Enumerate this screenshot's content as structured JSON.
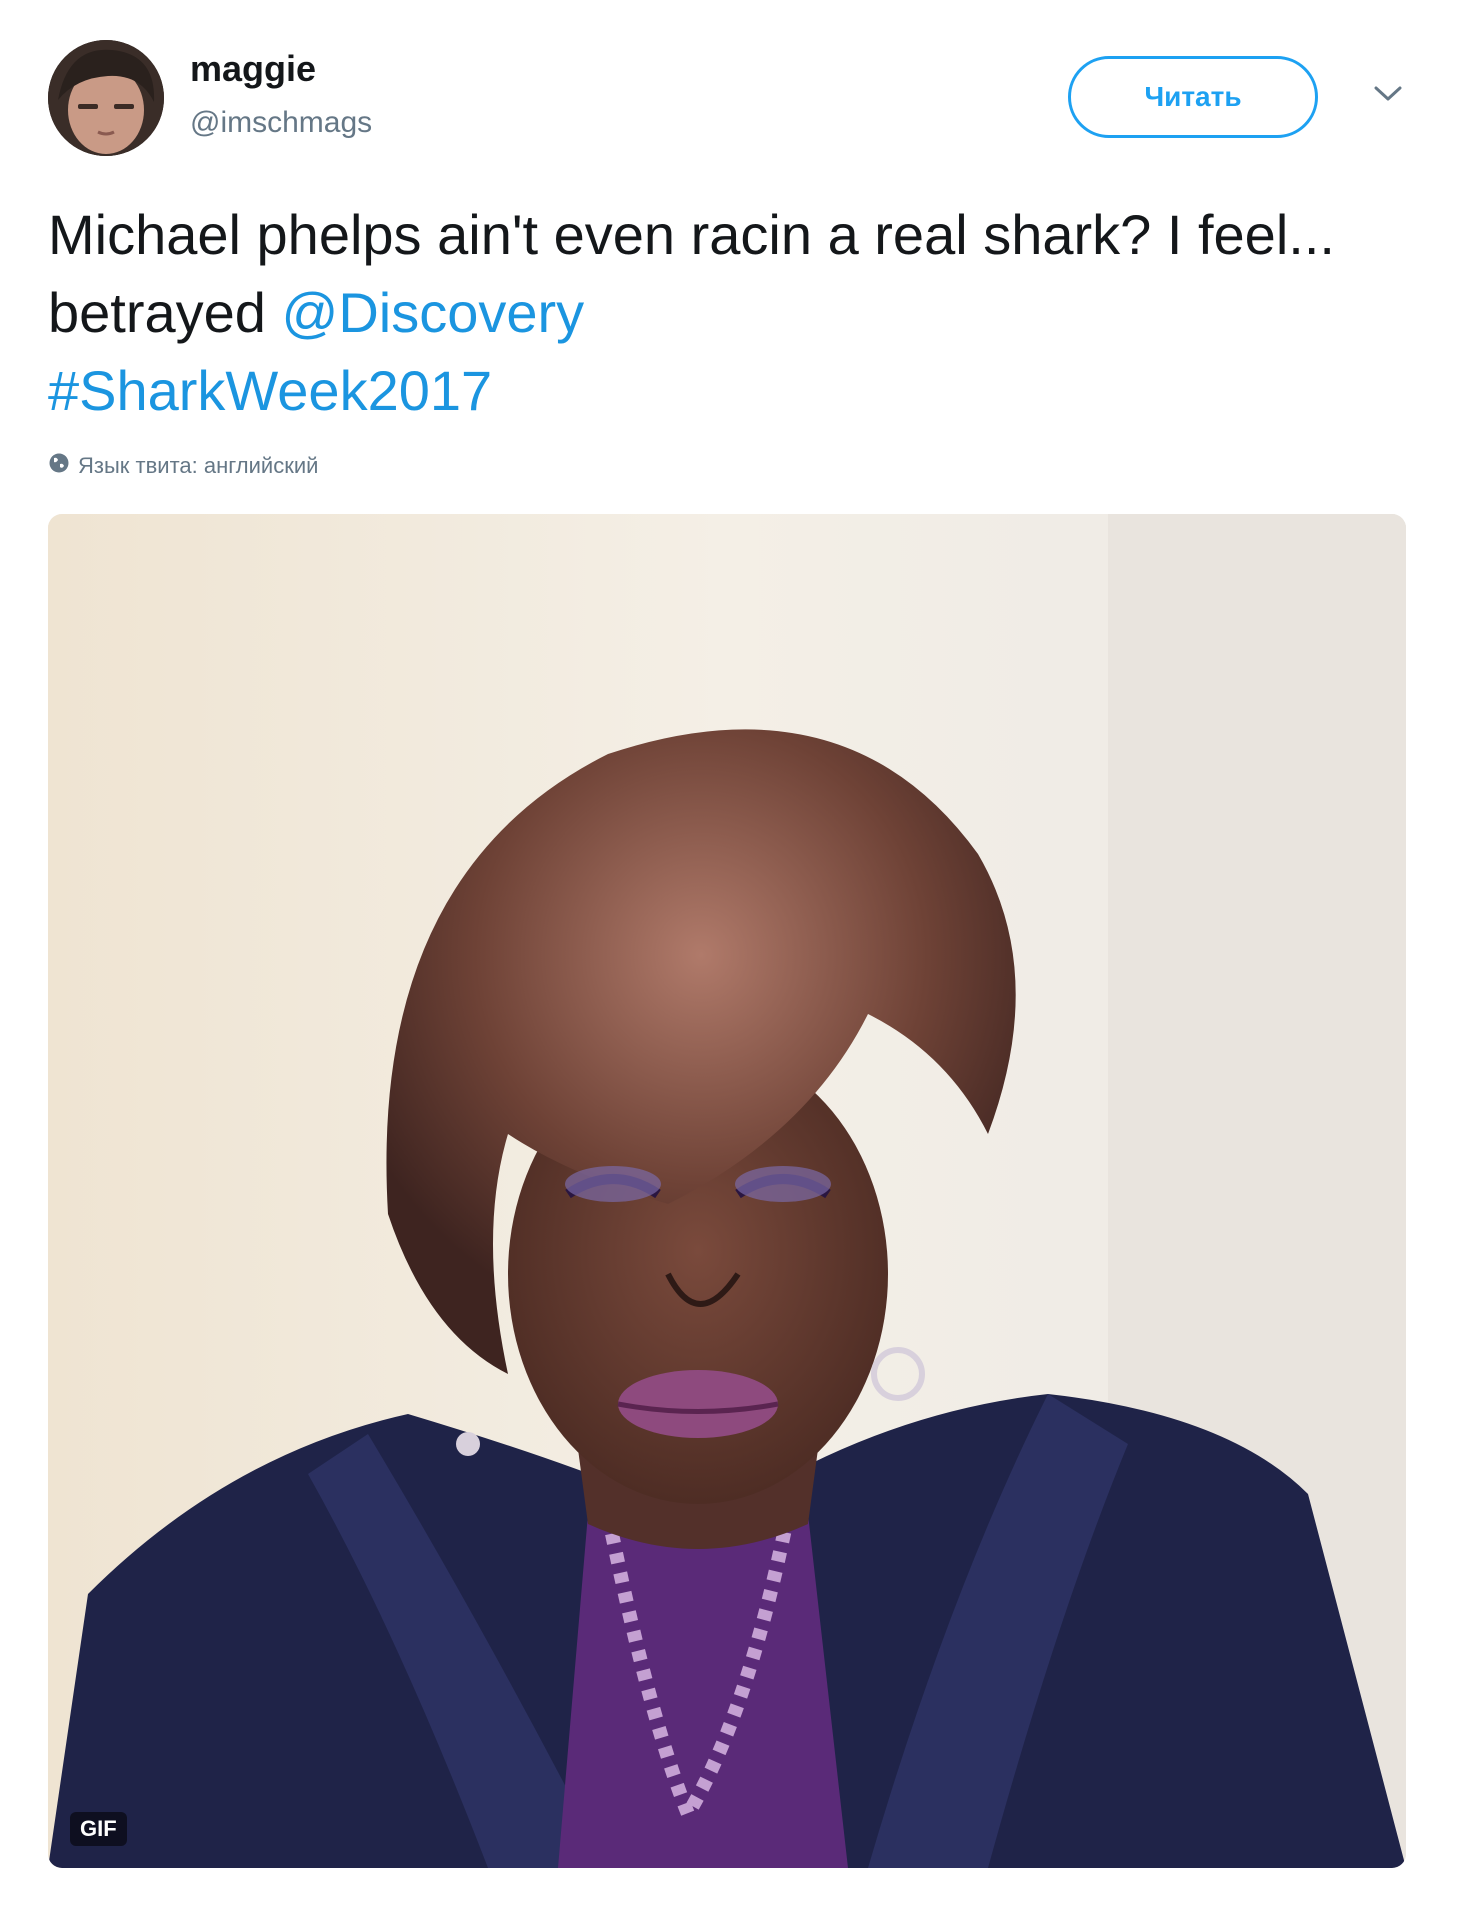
{
  "author": {
    "display_name": "maggie",
    "handle": "@imschmags"
  },
  "actions": {
    "follow_label": "Читать"
  },
  "tweet": {
    "text_part1": "Michael phelps ain't even racin a real shark? I feel... betrayed ",
    "mention": "@Discovery",
    "hashtag": "#SharkWeek2017",
    "language_label": "Язык твита: английский"
  },
  "media": {
    "badge": "GIF"
  },
  "colors": {
    "link": "#1b95e0",
    "follow_border": "#1da1f2",
    "secondary_text": "#657786"
  },
  "icons": {
    "caret": "chevron-down-icon",
    "globe": "globe-icon"
  }
}
